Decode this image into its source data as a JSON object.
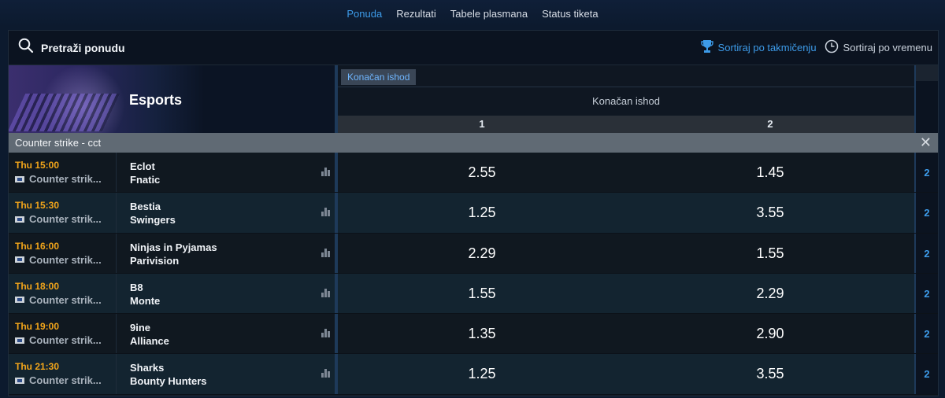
{
  "nav": {
    "items": [
      {
        "label": "Ponuda",
        "active": true
      },
      {
        "label": "Rezultati",
        "active": false
      },
      {
        "label": "Tabele plasmana",
        "active": false
      },
      {
        "label": "Status tiketa",
        "active": false
      }
    ]
  },
  "search": {
    "label": "Pretraži ponudu",
    "icon": "search-icon"
  },
  "sort": {
    "by_competition": "Sortiraj po takmičenju",
    "by_time": "Sortiraj po vremenu",
    "competition_icon": "trophy-icon",
    "time_icon": "clock-icon"
  },
  "sport": {
    "title": "Esports"
  },
  "market": {
    "tab": "Konačan ishod",
    "title": "Konačan ishod",
    "outcomes": [
      "1",
      "2"
    ]
  },
  "league": {
    "name": "Counter strike - cct",
    "close_icon": "close-icon"
  },
  "matches": [
    {
      "time": "Thu 15:00",
      "competition": "Counter strik...",
      "home": "Eclot",
      "away": "Fnatic",
      "odds": [
        "2.55",
        "1.45"
      ],
      "more": "2"
    },
    {
      "time": "Thu 15:30",
      "competition": "Counter strik...",
      "home": "Bestia",
      "away": "Swingers",
      "odds": [
        "1.25",
        "3.55"
      ],
      "more": "2"
    },
    {
      "time": "Thu 16:00",
      "competition": "Counter strik...",
      "home": "Ninjas in Pyjamas",
      "away": "Parivision",
      "odds": [
        "2.29",
        "1.55"
      ],
      "more": "2"
    },
    {
      "time": "Thu 18:00",
      "competition": "Counter strik...",
      "home": "B8",
      "away": "Monte",
      "odds": [
        "1.55",
        "2.29"
      ],
      "more": "2"
    },
    {
      "time": "Thu 19:00",
      "competition": "Counter strik...",
      "home": "9ine",
      "away": "Alliance",
      "odds": [
        "1.35",
        "2.90"
      ],
      "more": "2"
    },
    {
      "time": "Thu 21:30",
      "competition": "Counter strik...",
      "home": "Sharks",
      "away": "Bounty Hunters",
      "odds": [
        "1.25",
        "3.55"
      ],
      "more": "2"
    }
  ],
  "colors": {
    "accent": "#3d9be9",
    "time": "#f2a51a",
    "league_bar": "#606a74"
  }
}
